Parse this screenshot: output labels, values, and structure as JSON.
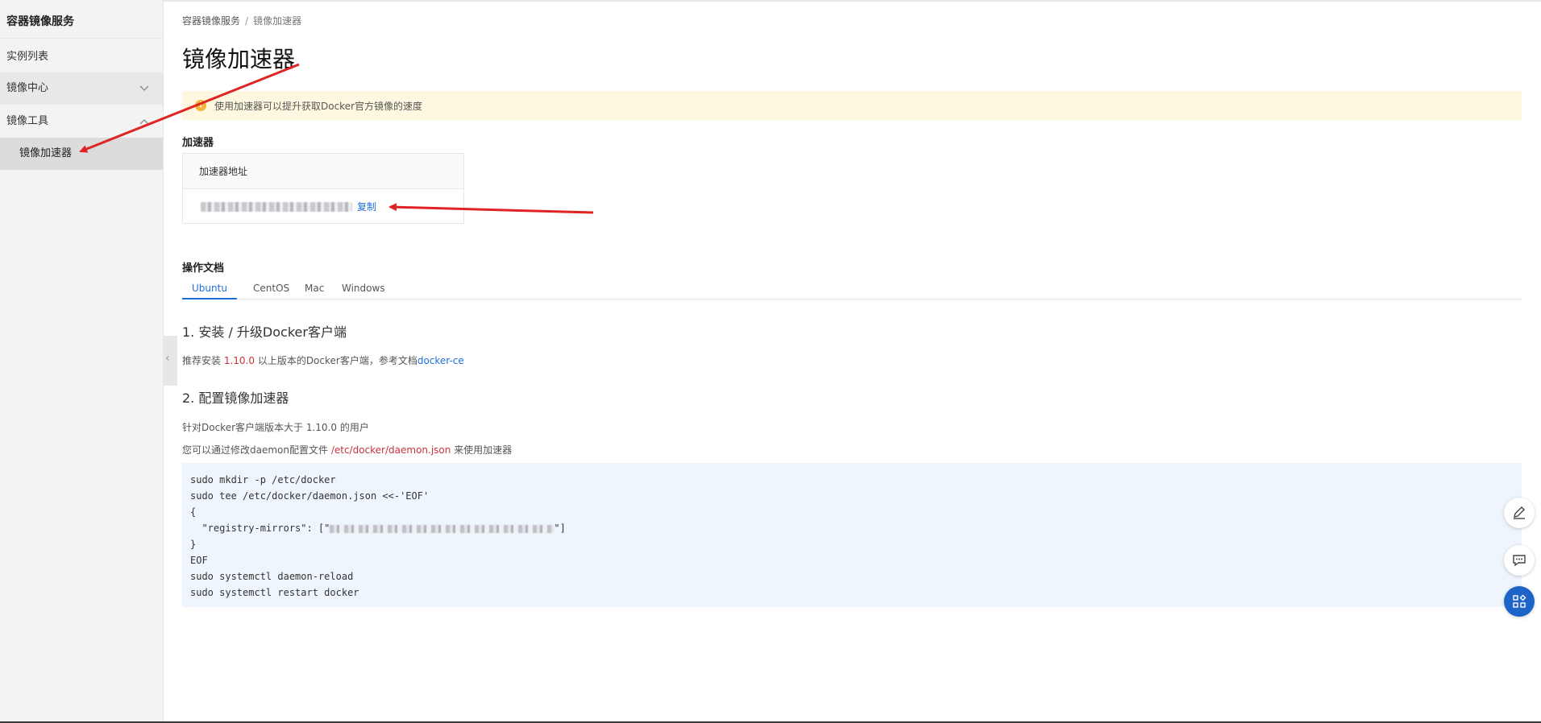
{
  "sidebar": {
    "title": "容器镜像服务",
    "items": [
      {
        "label": "实例列表"
      },
      {
        "label": "镜像中心"
      },
      {
        "label": "镜像工具"
      },
      {
        "label": "镜像加速器"
      }
    ]
  },
  "breadcrumb": {
    "root": "容器镜像服务",
    "separator": "/",
    "current": "镜像加速器"
  },
  "page": {
    "title": "镜像加速器"
  },
  "notice": {
    "icon": "warning-icon",
    "text": "使用加速器可以提升获取Docker官方镜像的速度"
  },
  "accelerator": {
    "section_title": "加速器",
    "header": "加速器地址",
    "copy_label": "复制"
  },
  "docs": {
    "section_title": "操作文档",
    "tabs": [
      {
        "label": "Ubuntu",
        "active": true
      },
      {
        "label": "CentOS",
        "active": false
      },
      {
        "label": "Mac",
        "active": false
      },
      {
        "label": "Windows",
        "active": false
      }
    ],
    "step1": {
      "title": "1. 安装 / 升级Docker客户端",
      "text_before": "推荐安装 ",
      "version": "1.10.0",
      "text_after": " 以上版本的Docker客户端，参考文档",
      "link": "docker-ce"
    },
    "step2": {
      "title": "2. 配置镜像加速器",
      "line1": "针对Docker客户端版本大于 1.10.0 的用户",
      "line2_before": "您可以通过修改daemon配置文件 ",
      "config_path": "/etc/docker/daemon.json",
      "line2_after": " 来使用加速器"
    },
    "code": {
      "l1": "sudo mkdir -p /etc/docker",
      "l2": "sudo tee /etc/docker/daemon.json <<-'EOF'",
      "l3": "{",
      "l4_before": "  \"registry-mirrors\": [\"",
      "l4_after": "\"]",
      "l5": "}",
      "l6": "EOF",
      "l7": "sudo systemctl daemon-reload",
      "l8": "sudo systemctl restart docker"
    }
  },
  "floating_buttons": [
    "edit-icon",
    "feedback-icon",
    "apps-icon"
  ],
  "colors": {
    "accent": "#ff6a00",
    "link": "#1e6fd9",
    "notice_bg": "#fff8e0",
    "code_bg": "#eef5fc",
    "annotation_arrow": "#e02424"
  }
}
